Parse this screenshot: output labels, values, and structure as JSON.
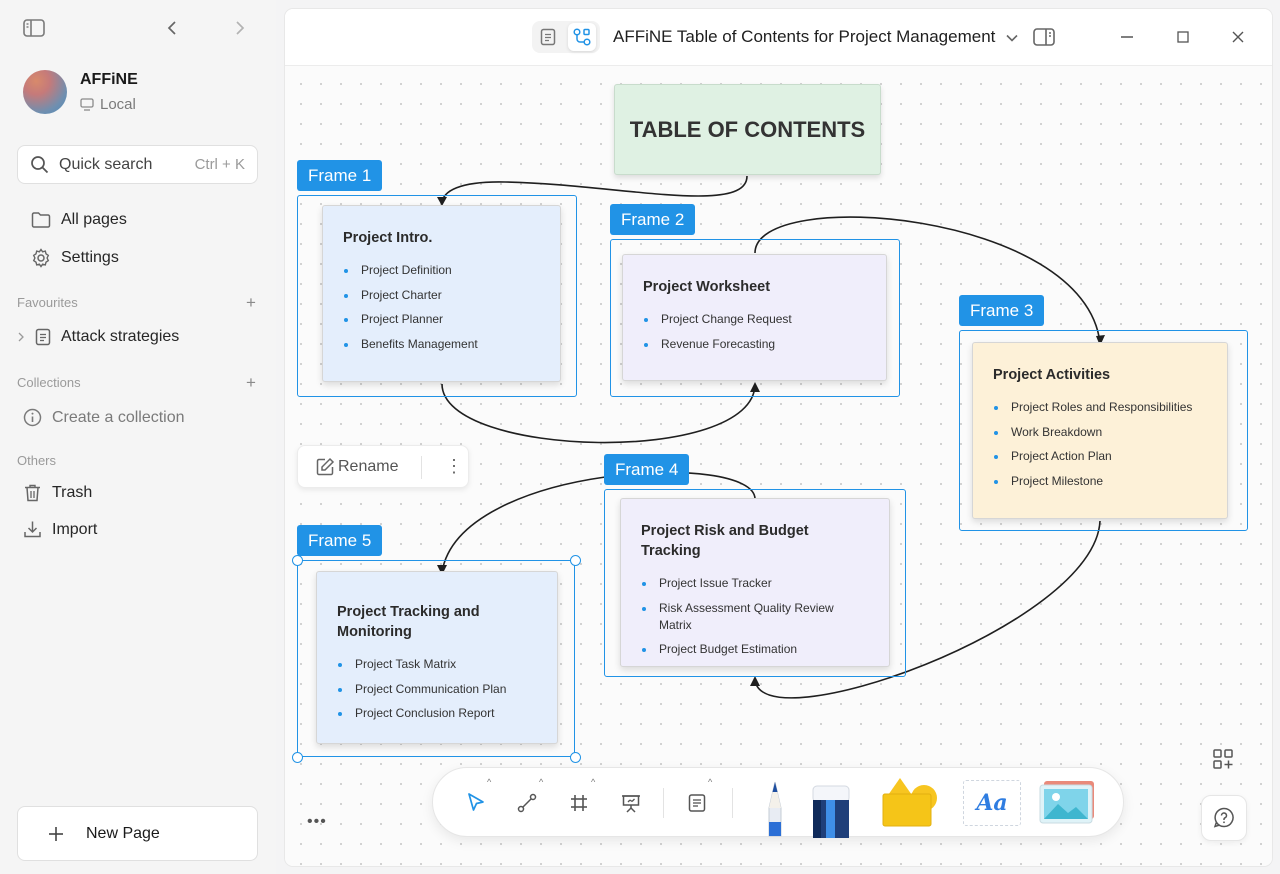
{
  "sidebar": {
    "workspace": {
      "name": "AFFiNE",
      "storage": "Local"
    },
    "search": {
      "label": "Quick search",
      "shortcut": "Ctrl + K"
    },
    "nav": {
      "all_pages": "All pages",
      "settings": "Settings"
    },
    "favourites": {
      "heading": "Favourites",
      "items": [
        {
          "label": "Attack strategies"
        }
      ]
    },
    "collections": {
      "heading": "Collections",
      "create": "Create a collection"
    },
    "others": {
      "heading": "Others",
      "trash": "Trash",
      "import": "Import"
    },
    "new_page": "New Page"
  },
  "header": {
    "title": "AFFiNE Table of Contents for Project Management",
    "mode": "edgeless"
  },
  "canvas": {
    "toc_title": "TABLE OF CONTENTS",
    "frames": [
      {
        "label": "Frame 1",
        "note": {
          "title": "Project Intro.",
          "items": [
            "Project Definition",
            "Project Charter",
            "Project Planner",
            "Benefits Management"
          ]
        }
      },
      {
        "label": "Frame 2",
        "note": {
          "title": "Project Worksheet",
          "items": [
            "Project Change Request",
            "Revenue Forecasting"
          ]
        }
      },
      {
        "label": "Frame 3",
        "note": {
          "title": "Project Activities",
          "items": [
            "Project Roles and Responsibilities",
            "Work Breakdown",
            "Project Action Plan",
            "Project Milestone"
          ]
        }
      },
      {
        "label": "Frame 4",
        "note": {
          "title": "Project Risk and Budget Tracking",
          "items": [
            "Project Issue Tracker",
            "Risk Assessment Quality Review Matrix",
            "Project Budget Estimation"
          ]
        }
      },
      {
        "label": "Frame 5",
        "note": {
          "title": "Project Tracking and Monitoring",
          "items": [
            "Project Task Matrix",
            "Project Communication Plan",
            "Project Conclusion Report"
          ]
        }
      }
    ],
    "selection_toolbar": {
      "rename": "Rename"
    },
    "text_tool_label": "Aa"
  },
  "colors": {
    "accent": "#2193e6",
    "toc_bg": "#dff1e3",
    "note_blue": "#e4eefc",
    "note_purple": "#f0eefb",
    "note_yellow": "#fdf1d8"
  }
}
